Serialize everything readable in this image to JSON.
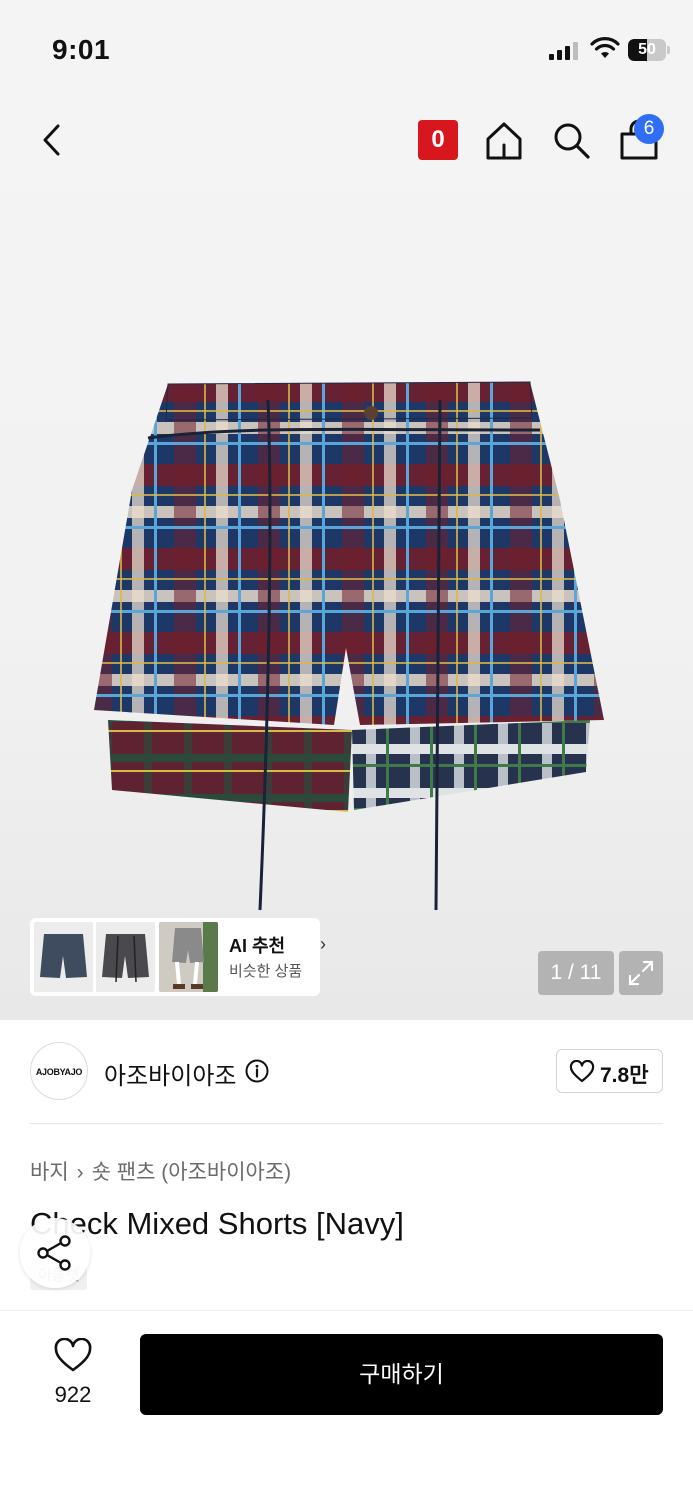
{
  "status_bar": {
    "time": "9:01",
    "battery": "50",
    "battery_level": 0.5
  },
  "header": {
    "badge": "0",
    "cart_count": "6",
    "icons": [
      "back-icon",
      "home-icon",
      "search-icon",
      "shopping-bag-icon"
    ]
  },
  "gallery": {
    "ai": {
      "title": "AI 추천",
      "subtitle": "비슷한 상품"
    },
    "counter": "1 / 11"
  },
  "brand": {
    "logo_text": "AJOBYAJO",
    "name": "아조바이아조",
    "likes": "7.8만"
  },
  "breadcrumb": {
    "category": "바지",
    "subcategory": "숏 팬츠 (아조바이아조)"
  },
  "product": {
    "title": "Check Mixed Shorts [Navy]",
    "tag": "아울렛"
  },
  "bottom_bar": {
    "wish_count": "922",
    "buy_label": "구매하기"
  },
  "colors": {
    "accent_red": "#d8161d",
    "badge_blue": "#2f6ef5",
    "buy_button": "#000000"
  }
}
